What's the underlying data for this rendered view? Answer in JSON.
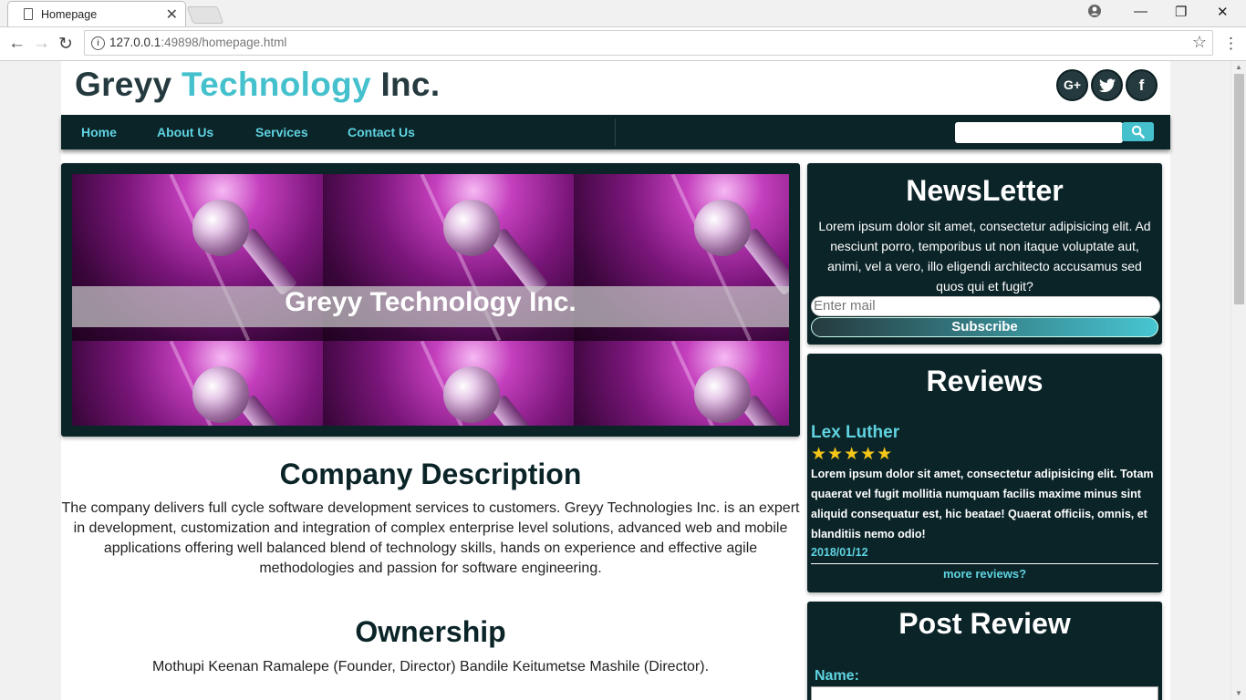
{
  "browser": {
    "tab_title": "Homepage",
    "url_host": "127.0.0.1",
    "url_rest": ":49898/homepage.html"
  },
  "site": {
    "logo_part1": "Greyy ",
    "logo_accent": "Technology",
    "logo_part3": " Inc.",
    "nav": [
      "Home",
      "About Us",
      "Services",
      "Contact Us"
    ],
    "search_placeholder": ""
  },
  "hero": {
    "caption": "Greyy Technology Inc."
  },
  "company": {
    "title": "Company Description",
    "text": "The company delivers full cycle software development services to customers. Greyy Technologies Inc. is an expert in development, customization and integration of complex enterprise level solutions, advanced web and mobile applications offering well balanced blend of technology skills, hands on experience and effective agile methodologies and passion for software engineering."
  },
  "ownership": {
    "title": "Ownership",
    "text": "Mothupi Keenan Ramalepe (Founder, Director) Bandile Keitumetse Mashile (Director)."
  },
  "newsletter": {
    "title": "NewsLetter",
    "text": "Lorem ipsum dolor sit amet, consectetur adipisicing elit. Ad nesciunt porro, temporibus ut non itaque voluptate aut, animi, vel a vero, illo eligendi architecto accusamus sed quos qui et fugit?",
    "email_placeholder": "Enter mail",
    "button": "Subscribe"
  },
  "reviews": {
    "title": "Reviews",
    "name": "Lex Luther",
    "rating": 5,
    "stars": "★★★★★",
    "text": "Lorem ipsum dolor sit amet, consectetur adipisicing elit. Totam quaerat vel fugit mollitia numquam facilis maxime minus sint aliquid consequatur est, hic beatae! Quaerat officiis, omnis, et blanditiis nemo odio!",
    "date": "2018/01/12",
    "more": "more reviews?"
  },
  "post_review": {
    "title": "Post Review",
    "name_label": "Name:"
  },
  "colors": {
    "dark": "#0b2428",
    "accent": "#45c1cd",
    "link": "#5fd3e0",
    "star": "#f5c518"
  }
}
